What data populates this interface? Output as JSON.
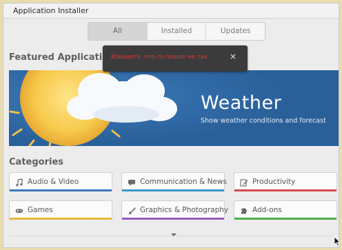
{
  "window": {
    "title": "Application Installer"
  },
  "tabs": [
    {
      "label": "All",
      "active": true
    },
    {
      "label": "Installed",
      "active": false
    },
    {
      "label": "Updates",
      "active": false
    }
  ],
  "featured": {
    "heading": "Featured Application",
    "app_name": "Weather",
    "app_description": "Show weather conditions and forecast",
    "background_color": "#2d6aa6"
  },
  "toast": {
    "message": "Извините, что-то пошло не так.",
    "message_color": "#d63a3a",
    "close_label": "×"
  },
  "categories": {
    "heading": "Categories",
    "items": [
      {
        "label": "Audio & Video",
        "icon": "music-note-icon",
        "color": "#3a78b8"
      },
      {
        "label": "Communication & News",
        "icon": "chat-bubble-icon",
        "color": "#3d95c6"
      },
      {
        "label": "Productivity",
        "icon": "edit-icon",
        "color": "#d84a4a"
      },
      {
        "label": "Games",
        "icon": "gamepad-icon",
        "color": "#e0b93a"
      },
      {
        "label": "Graphics & Photography",
        "icon": "paint-brush-icon",
        "color": "#9b59b6"
      },
      {
        "label": "Add-ons",
        "icon": "puzzle-piece-icon",
        "color": "#4cae4c"
      }
    ]
  }
}
